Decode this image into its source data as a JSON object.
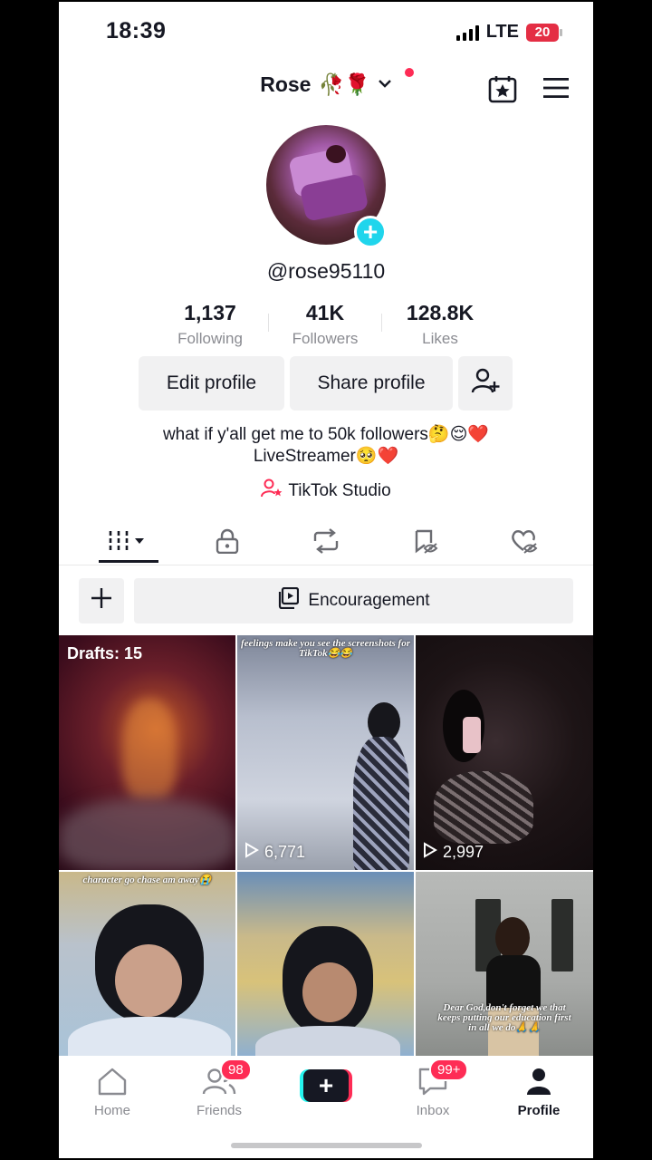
{
  "status_bar": {
    "time": "18:39",
    "network": "LTE",
    "battery": "20"
  },
  "header": {
    "name": "Rose",
    "emojis": "🥀🌹"
  },
  "profile": {
    "username": "@rose95110"
  },
  "stats": [
    {
      "value": "1,137",
      "label": "Following"
    },
    {
      "value": "41K",
      "label": "Followers"
    },
    {
      "value": "128.8K",
      "label": "Likes"
    }
  ],
  "actions": {
    "edit": "Edit profile",
    "share": "Share profile"
  },
  "bio": {
    "line1": "what if y'all get me to 50k followers🤔😌❤️",
    "line2": "LiveStreamer🥺❤️"
  },
  "studio": {
    "label": "TikTok Studio"
  },
  "collection": {
    "label": "Encouragement"
  },
  "videos": [
    {
      "drafts": "Drafts: 15"
    },
    {
      "views": "6,771",
      "caption": "feelings make you see the screenshots for TikTok😂😂"
    },
    {
      "views": "2,997"
    },
    {
      "caption": "character go chase am away😭"
    },
    {},
    {
      "caption": "Dear God,don't forget we that keeps putting our education first in all we do🙏🙏"
    }
  ],
  "nav": {
    "home": "Home",
    "friends": "Friends",
    "friends_badge": "98",
    "inbox": "Inbox",
    "inbox_badge": "99+",
    "profile": "Profile"
  },
  "colors": {
    "accent": "#fe2c55",
    "cyan": "#25f4ee",
    "avatar_plus": "#20d5ec"
  }
}
